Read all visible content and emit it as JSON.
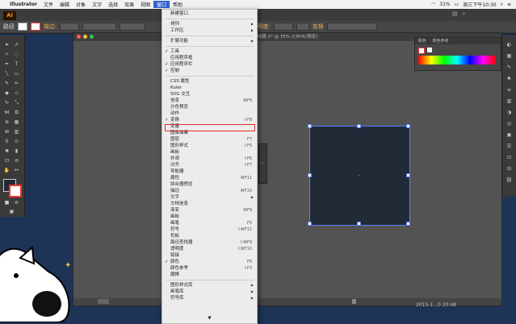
{
  "menubar": {
    "apple": "",
    "items": [
      "Illustrator",
      "文件",
      "编辑",
      "对象",
      "文字",
      "选择",
      "效果",
      "视图",
      "窗口",
      "帮助"
    ],
    "active_index": 8,
    "clock": "周三下午10:30",
    "battery": "31%"
  },
  "control": {
    "logo": "Ai",
    "path_label": "路径",
    "stroke_label": "描边:",
    "opacity_label": "不透明度:",
    "transform_label": "变换"
  },
  "document": {
    "title": "未标题-1* @ 75% (CMYK/预览)"
  },
  "window_menu": {
    "items": [
      {
        "label": "新建窗口",
        "sc": "",
        "chk": false,
        "sub": false
      },
      {
        "sep": true
      },
      {
        "label": "排列",
        "sc": "",
        "chk": false,
        "sub": true
      },
      {
        "label": "工作区",
        "sc": "",
        "chk": false,
        "sub": true
      },
      {
        "sep": true
      },
      {
        "label": "扩展功能",
        "sc": "",
        "chk": false,
        "sub": true
      },
      {
        "sep": true
      },
      {
        "label": "工具",
        "sc": "",
        "chk": true,
        "sub": false
      },
      {
        "label": "应用程序框",
        "sc": "",
        "chk": false,
        "sub": false
      },
      {
        "label": "应用程序栏",
        "sc": "",
        "chk": true,
        "sub": false
      },
      {
        "label": "控制",
        "sc": "",
        "chk": true,
        "sub": false
      },
      {
        "sep": true
      },
      {
        "label": "CSS 属性",
        "sc": "",
        "chk": false,
        "sub": false
      },
      {
        "label": "Kuler",
        "sc": "",
        "chk": false,
        "sub": false
      },
      {
        "label": "SVG 交互",
        "sc": "",
        "chk": false,
        "sub": false
      },
      {
        "label": "信息",
        "sc": "⌘F8",
        "chk": false,
        "sub": false
      },
      {
        "label": "分色预览",
        "sc": "",
        "chk": false,
        "sub": false
      },
      {
        "label": "动作",
        "sc": "",
        "chk": false,
        "sub": false
      },
      {
        "label": "变换",
        "sc": "⇧F8",
        "chk": true,
        "sub": false
      },
      {
        "label": "变量",
        "sc": "",
        "chk": false,
        "sub": false
      },
      {
        "label": "图像描摹",
        "sc": "",
        "chk": false,
        "sub": false
      },
      {
        "label": "图层",
        "sc": "F7",
        "chk": false,
        "sub": false
      },
      {
        "label": "图形样式",
        "sc": "⇧F5",
        "chk": false,
        "sub": false
      },
      {
        "label": "画板",
        "sc": "",
        "chk": false,
        "sub": false
      },
      {
        "label": "外观",
        "sc": "⇧F6",
        "chk": false,
        "sub": false
      },
      {
        "label": "对齐",
        "sc": "⇧F7",
        "chk": false,
        "sub": false
      },
      {
        "label": "导航器",
        "sc": "",
        "chk": false,
        "sub": false
      },
      {
        "label": "属性",
        "sc": "⌘F11",
        "chk": false,
        "sub": false
      },
      {
        "label": "拼合器预览",
        "sc": "",
        "chk": false,
        "sub": false
      },
      {
        "label": "描边",
        "sc": "⌘F10",
        "chk": false,
        "sub": false
      },
      {
        "label": "文字",
        "sc": "",
        "chk": false,
        "sub": true
      },
      {
        "label": "文档信息",
        "sc": "",
        "chk": false,
        "sub": false
      },
      {
        "label": "渐变",
        "sc": "⌘F9",
        "chk": false,
        "sub": false
      },
      {
        "label": "画板",
        "sc": "",
        "chk": false,
        "sub": false
      },
      {
        "label": "画笔",
        "sc": "F5",
        "chk": false,
        "sub": false
      },
      {
        "label": "符号",
        "sc": "⇧⌘F11",
        "chk": false,
        "sub": false
      },
      {
        "label": "色板",
        "sc": "",
        "chk": false,
        "sub": false
      },
      {
        "label": "路径查找器",
        "sc": "⇧⌘F9",
        "chk": false,
        "sub": false
      },
      {
        "label": "透明度",
        "sc": "⇧⌘F10",
        "chk": false,
        "sub": false
      },
      {
        "label": "链接",
        "sc": "",
        "chk": false,
        "sub": false
      },
      {
        "label": "颜色",
        "sc": "F6",
        "chk": true,
        "sub": false
      },
      {
        "label": "颜色参考",
        "sc": "⇧F3",
        "chk": false,
        "sub": false
      },
      {
        "label": "魔棒",
        "sc": "",
        "chk": false,
        "sub": false
      },
      {
        "sep": true
      },
      {
        "label": "图形样式库",
        "sc": "",
        "chk": false,
        "sub": true
      },
      {
        "label": "画笔库",
        "sc": "",
        "chk": false,
        "sub": true
      },
      {
        "label": "符号库",
        "sc": "",
        "chk": false,
        "sub": true
      }
    ],
    "more_arrow": "▼"
  },
  "color_panel": {
    "tab1": "颜色",
    "tab2": "颜色参考"
  },
  "timestamp": "2015-1...0 20:48",
  "colors": {
    "accent": "#2f63d0",
    "highlight_box": "#e03030",
    "desktop": "#1d3456",
    "selection": "#5a7fff"
  }
}
